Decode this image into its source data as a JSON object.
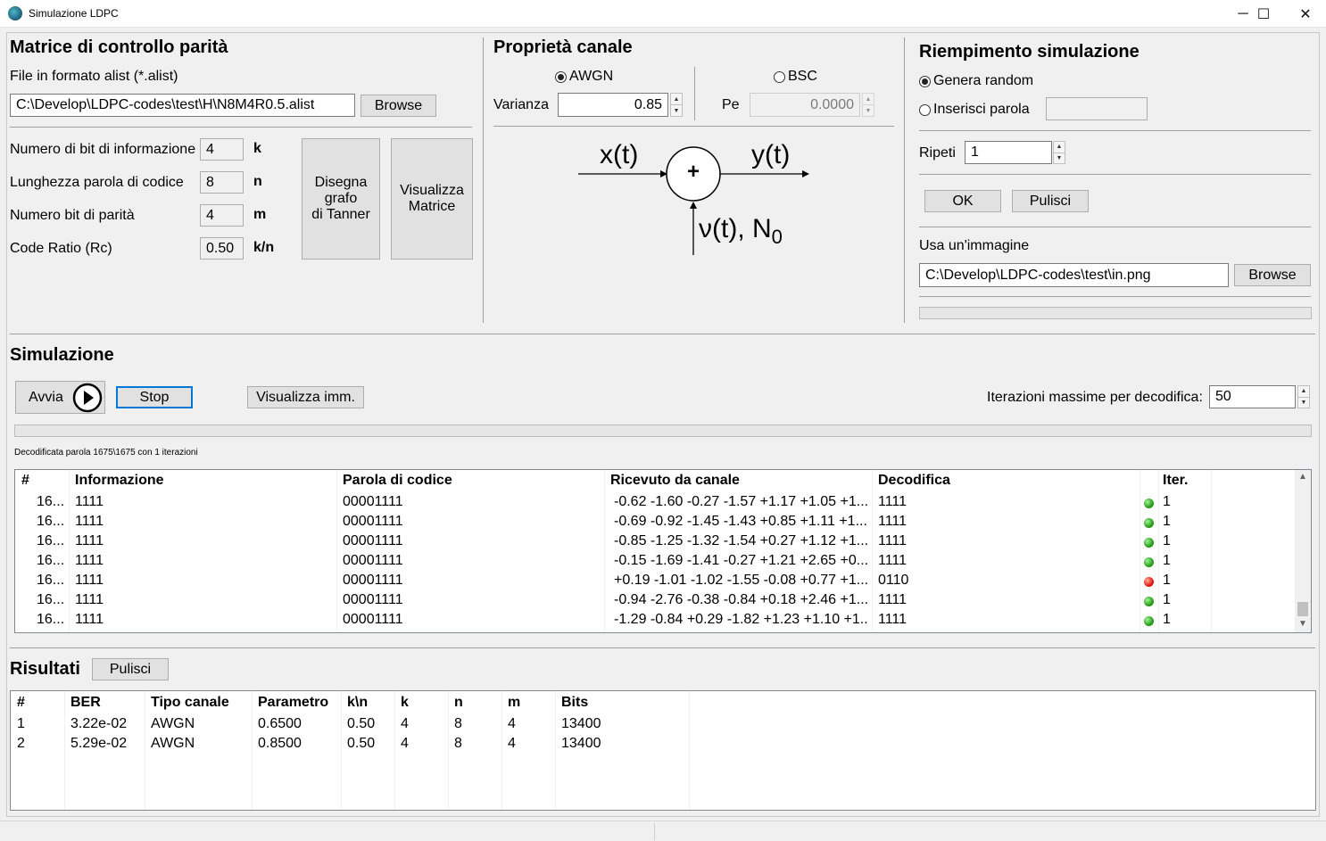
{
  "window": {
    "title": "Simulazione LDPC",
    "minimize": "─",
    "maximize": "☐",
    "close": "✕"
  },
  "parity": {
    "title": "Matrice di controllo parità",
    "file_label": "File in formato alist (*.alist)",
    "file_path": "C:\\Develop\\LDPC-codes\\test\\H\\N8M4R0.5.alist",
    "browse": "Browse",
    "rows": [
      {
        "label": "Numero di bit di informazione",
        "value": "4",
        "unit": "k"
      },
      {
        "label": "Lunghezza parola di codice",
        "value": "8",
        "unit": "n"
      },
      {
        "label": "Numero bit di parità",
        "value": "4",
        "unit": "m"
      },
      {
        "label": "Code Ratio (Rc)",
        "value": "0.50",
        "unit": "k/n"
      }
    ],
    "tanner_button": "Disegna\ngrafo\ndi Tanner",
    "matrix_button": "Visualizza\nMatrice"
  },
  "channel": {
    "title": "Proprietà canale",
    "awgn": "AWGN",
    "bsc": "BSC",
    "varianza_label": "Varianza",
    "varianza_value": "0.85",
    "pe_label": "Pe",
    "pe_value": "0.0000",
    "selected": "AWGN",
    "diagram": {
      "input": "x(t)",
      "output": "y(t)",
      "noise": "ν(t), N",
      "noise_sub": "0",
      "op": "+"
    }
  },
  "fill": {
    "title": "Riempimento simulazione",
    "random": "Genera random",
    "insert": "Inserisci parola",
    "selected": "random",
    "repeat_label": "Ripeti",
    "repeat_value": "1",
    "ok": "OK",
    "clear": "Pulisci",
    "image_label": "Usa un'immagine",
    "image_path": "C:\\Develop\\LDPC-codes\\test\\in.png",
    "browse": "Browse"
  },
  "simulation": {
    "title": "Simulazione",
    "start": "Avvia",
    "stop": "Stop",
    "view_image": "Visualizza imm.",
    "max_iter_label": "Iterazioni massime per decodifica:",
    "max_iter_value": "50",
    "status": "Decodificata parola 1675\\1675 con 1 iterazioni",
    "columns": [
      "#",
      "Informazione",
      "Parola di codice",
      "Ricevuto da canale",
      "Decodifica",
      "",
      "Iter."
    ],
    "rows": [
      {
        "n": "16...",
        "info": "1111",
        "code": "00001111",
        "recv": "-0.62 -1.60 -0.27 -1.57 +1.17 +1.05 +1....",
        "dec": "1111",
        "ok": true,
        "iter": "1"
      },
      {
        "n": "16...",
        "info": "1111",
        "code": "00001111",
        "recv": "-0.69 -0.92 -1.45 -1.43 +0.85 +1.11 +1....",
        "dec": "1111",
        "ok": true,
        "iter": "1"
      },
      {
        "n": "16...",
        "info": "1111",
        "code": "00001111",
        "recv": "-0.85 -1.25 -1.32 -1.54 +0.27 +1.12 +1....",
        "dec": "1111",
        "ok": true,
        "iter": "1"
      },
      {
        "n": "16...",
        "info": "1111",
        "code": "00001111",
        "recv": "-0.15 -1.69 -1.41 -0.27 +1.21 +2.65 +0....",
        "dec": "1111",
        "ok": true,
        "iter": "1"
      },
      {
        "n": "16...",
        "info": "1111",
        "code": "00001111",
        "recv": "+0.19 -1.01 -1.02 -1.55 -0.08 +0.77 +1....",
        "dec": "0110",
        "ok": false,
        "iter": "1"
      },
      {
        "n": "16...",
        "info": "1111",
        "code": "00001111",
        "recv": "-0.94 -2.76 -0.38 -0.84 +0.18 +2.46 +1....",
        "dec": "1111",
        "ok": true,
        "iter": "1"
      },
      {
        "n": "16...",
        "info": "1111",
        "code": "00001111",
        "recv": "-1.29 -0.84 +0.29 -1.82 +1.23 +1.10 +1....",
        "dec": "1111",
        "ok": true,
        "iter": "1"
      }
    ]
  },
  "results": {
    "title": "Risultati",
    "clear": "Pulisci",
    "columns": [
      "#",
      "BER",
      "Tipo canale",
      "Parametro",
      "k\\n",
      "k",
      "n",
      "m",
      "Bits"
    ],
    "rows": [
      [
        "1",
        "3.22e-02",
        "AWGN",
        "0.6500",
        "0.50",
        "4",
        "8",
        "4",
        "13400"
      ],
      [
        "2",
        "5.29e-02",
        "AWGN",
        "0.8500",
        "0.50",
        "4",
        "8",
        "4",
        "13400"
      ]
    ]
  }
}
